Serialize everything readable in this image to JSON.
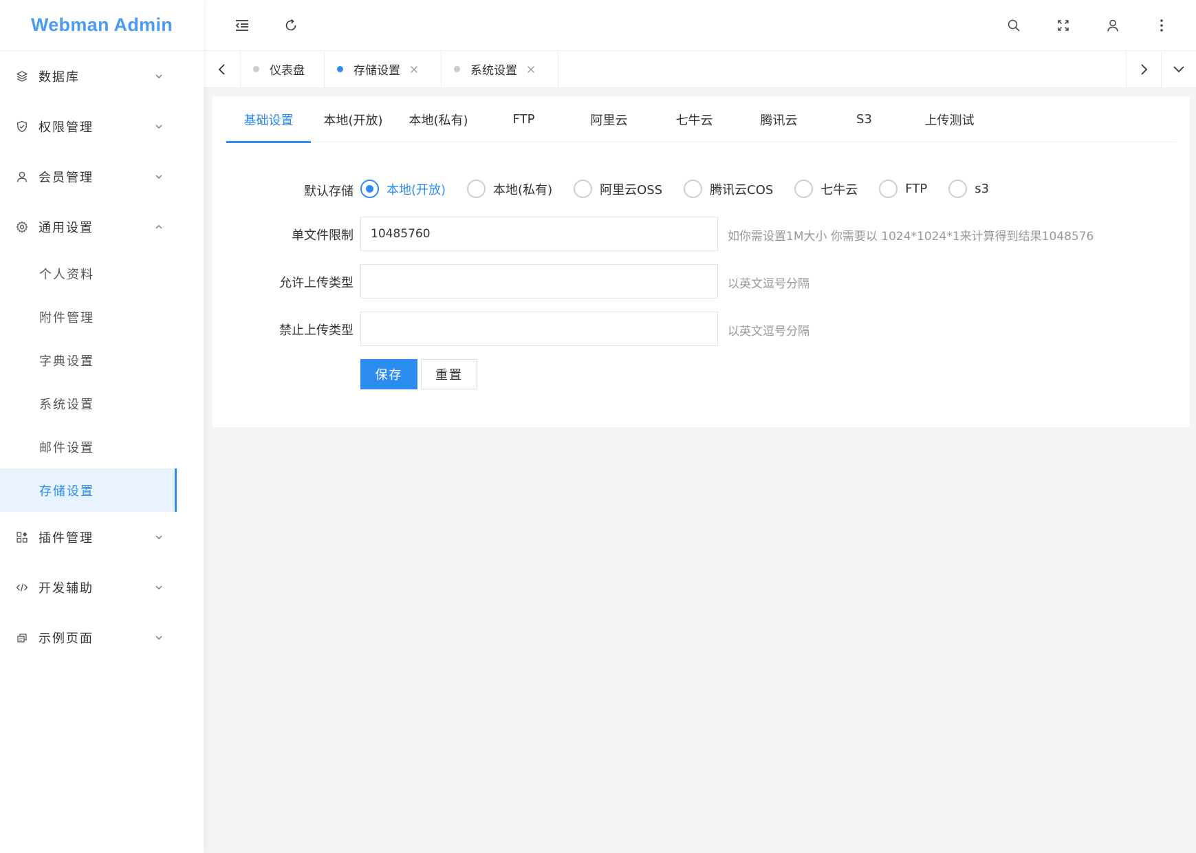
{
  "app": {
    "title": "Webman Admin"
  },
  "sidebar": {
    "items": [
      {
        "label": "数据库",
        "icon": "layers-icon"
      },
      {
        "label": "权限管理",
        "icon": "shield-check-icon"
      },
      {
        "label": "会员管理",
        "icon": "user-icon"
      },
      {
        "label": "通用设置",
        "icon": "gear-icon",
        "expanded": true
      }
    ],
    "sub_items": [
      {
        "label": "个人资料"
      },
      {
        "label": "附件管理"
      },
      {
        "label": "字典设置"
      },
      {
        "label": "系统设置"
      },
      {
        "label": "邮件设置"
      },
      {
        "label": "存储设置",
        "active": true
      }
    ],
    "items_after": [
      {
        "label": "插件管理",
        "icon": "apps-icon"
      },
      {
        "label": "开发辅助",
        "icon": "code-icon"
      },
      {
        "label": "示例页面",
        "icon": "page-icon"
      }
    ]
  },
  "header": {
    "left_icons": [
      "menu-fold-icon",
      "refresh-icon"
    ],
    "right_icons": [
      "search-icon",
      "fullscreen-icon",
      "user-icon",
      "more-icon"
    ]
  },
  "page_tabs": [
    {
      "label": "仪表盘",
      "closable": false,
      "active": false
    },
    {
      "label": "存储设置",
      "closable": true,
      "active": true
    },
    {
      "label": "系统设置",
      "closable": true,
      "active": false
    }
  ],
  "settings_tabs": [
    {
      "label": "基础设置",
      "active": true
    },
    {
      "label": "本地(开放)"
    },
    {
      "label": "本地(私有)"
    },
    {
      "label": "FTP"
    },
    {
      "label": "阿里云"
    },
    {
      "label": "七牛云"
    },
    {
      "label": "腾讯云"
    },
    {
      "label": "S3"
    },
    {
      "label": "上传测试"
    }
  ],
  "form": {
    "default_storage": {
      "label": "默认存储",
      "options": [
        "本地(开放)",
        "本地(私有)",
        "阿里云OSS",
        "腾讯云COS",
        "七牛云",
        "FTP",
        "s3"
      ],
      "selected": "本地(开放)"
    },
    "file_limit": {
      "label": "单文件限制",
      "value": "10485760",
      "hint": "如你需设置1M大小 你需要以 1024*1024*1来计算得到结果1048576"
    },
    "allow_types": {
      "label": "允许上传类型",
      "value": "",
      "hint": "以英文逗号分隔"
    },
    "deny_types": {
      "label": "禁止上传类型",
      "value": "",
      "hint": "以英文逗号分隔"
    },
    "save_label": "保存",
    "reset_label": "重置"
  },
  "colors": {
    "accent": "#2d8cf0",
    "logo": "#4a9bf2",
    "background": "#f4f4f4",
    "active_menu_bg": "#e8f3ff"
  }
}
